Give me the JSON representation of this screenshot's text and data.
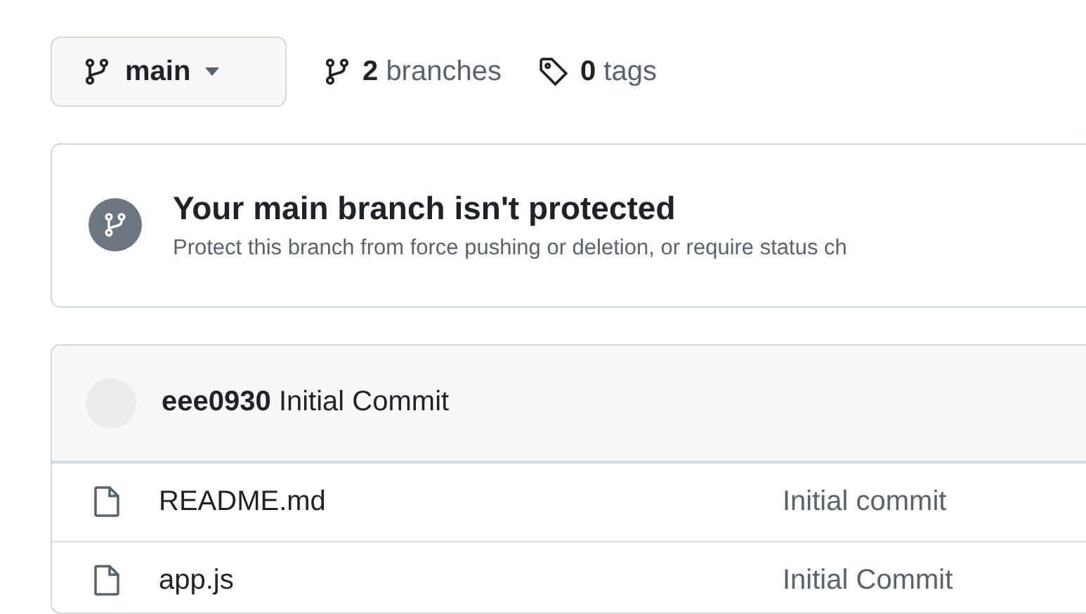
{
  "branch_selector": {
    "label": "main"
  },
  "counts": [
    {
      "kind": "branches",
      "number": "2",
      "label": "branches"
    },
    {
      "kind": "tags",
      "number": "0",
      "label": "tags"
    }
  ],
  "protection_notice": {
    "title": "Your main branch isn't protected",
    "description": "Protect this branch from force pushing or deletion, or require status ch"
  },
  "latest_commit": {
    "author": "eee0930",
    "message": "Initial Commit"
  },
  "files": [
    {
      "name": "README.md",
      "commit_message": "Initial commit"
    },
    {
      "name": "app.js",
      "commit_message": "Initial Commit"
    }
  ]
}
